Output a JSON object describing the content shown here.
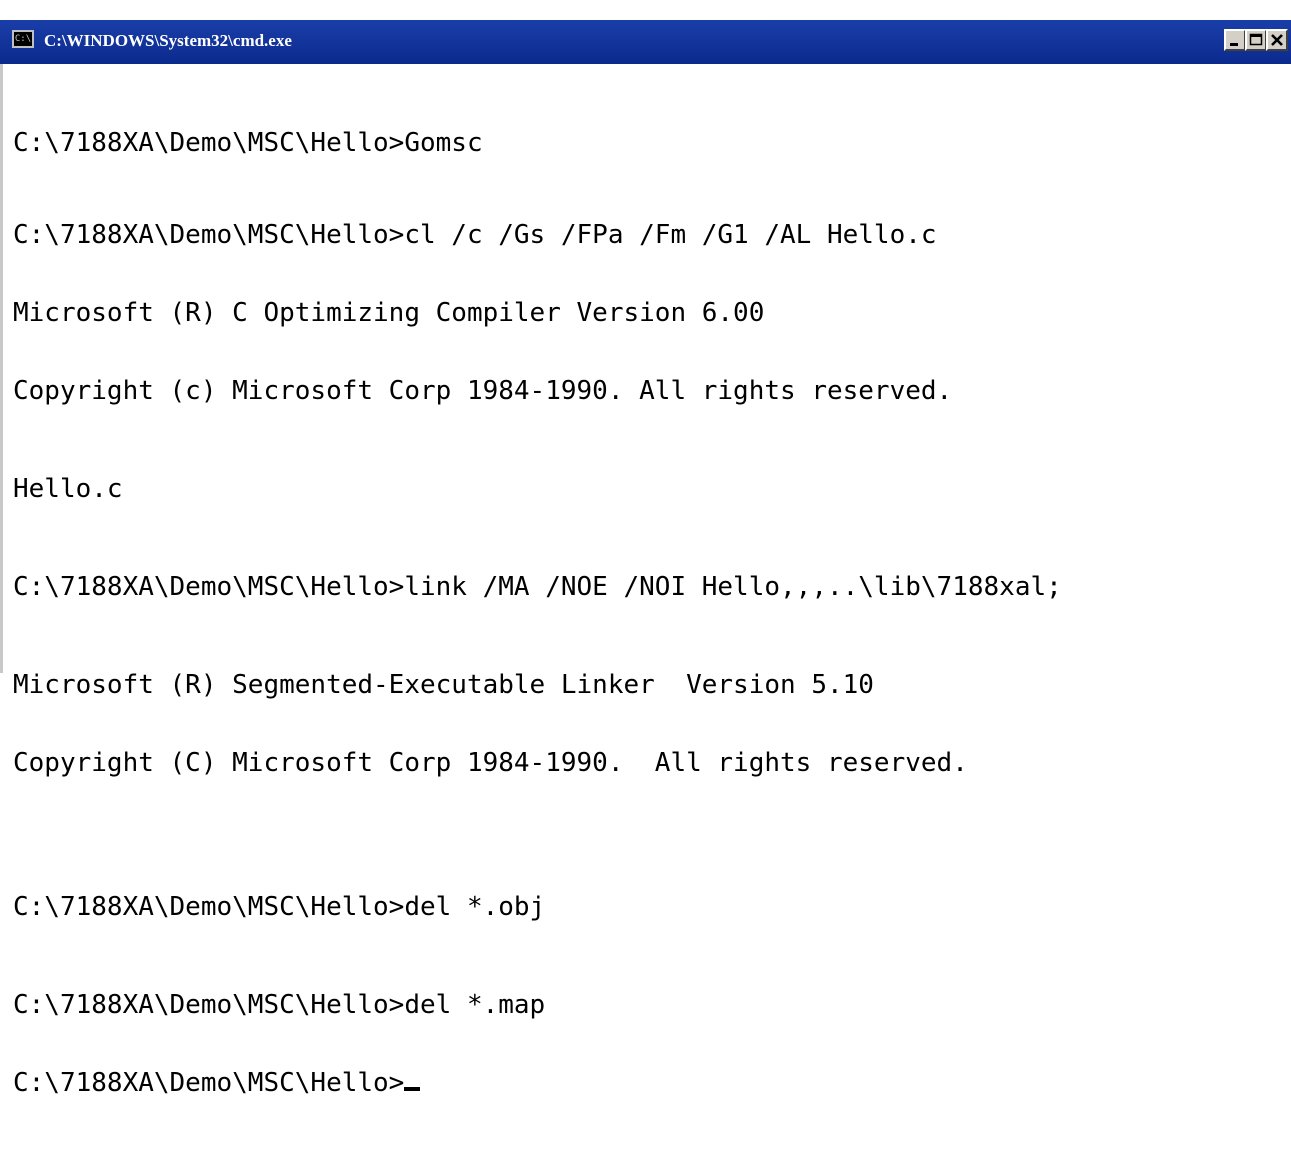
{
  "window": {
    "title": "C:\\WINDOWS\\System32\\cmd.exe",
    "icon": "console-icon",
    "controls": [
      "minimize-icon",
      "maximize-icon",
      "close-icon"
    ]
  },
  "console": {
    "lines": [
      "C:\\7188XA\\Demo\\MSC\\Hello>Gomsc",
      "C:\\7188XA\\Demo\\MSC\\Hello>cl /c /Gs /FPa /Fm /G1 /AL Hello.c",
      "Microsoft (R) C Optimizing Compiler Version 6.00",
      "Copyright (c) Microsoft Corp 1984-1990. All rights reserved.",
      "Hello.c",
      "C:\\7188XA\\Demo\\MSC\\Hello>link /MA /NOE /NOI Hello,,,..\\lib\\7188xal;",
      "Microsoft (R) Segmented-Executable Linker  Version 5.10",
      "Copyright (C) Microsoft Corp 1984-1990.  All rights reserved.",
      "C:\\7188XA\\Demo\\MSC\\Hello>del *.obj",
      "C:\\7188XA\\Demo\\MSC\\Hello>del *.map",
      "C:\\7188XA\\Demo\\MSC\\Hello>"
    ]
  },
  "colors": {
    "titlebar": "#0b2a8e",
    "title_text": "#ffffff",
    "console_bg": "#ffffff",
    "console_text": "#000000"
  }
}
